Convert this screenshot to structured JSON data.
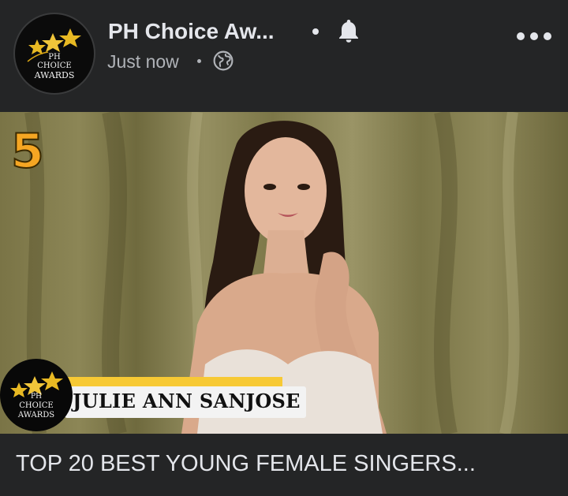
{
  "post": {
    "page_name": "PH Choice Aw...",
    "time": "Just now",
    "privacy_icon": "globe-icon",
    "notify_icon": "bell-icon",
    "more_icon": "more-horizontal-icon"
  },
  "logo": {
    "line1": "PH",
    "line2": "CHOICE",
    "line3": "AWARDS"
  },
  "image": {
    "rank": "5",
    "name": "JULIE ANN SANJOSE",
    "badge_line1": "PH",
    "badge_line2": "CHOICE",
    "badge_line3": "AWARDS"
  },
  "caption": {
    "text": "TOP 20 BEST YOUNG FEMALE SINGERS..."
  },
  "colors": {
    "background": "#242526",
    "text_primary": "#e4e6eb",
    "text_secondary": "#b0b3b8",
    "rank_orange": "#f5a623",
    "star_gold": "#e8b923"
  }
}
